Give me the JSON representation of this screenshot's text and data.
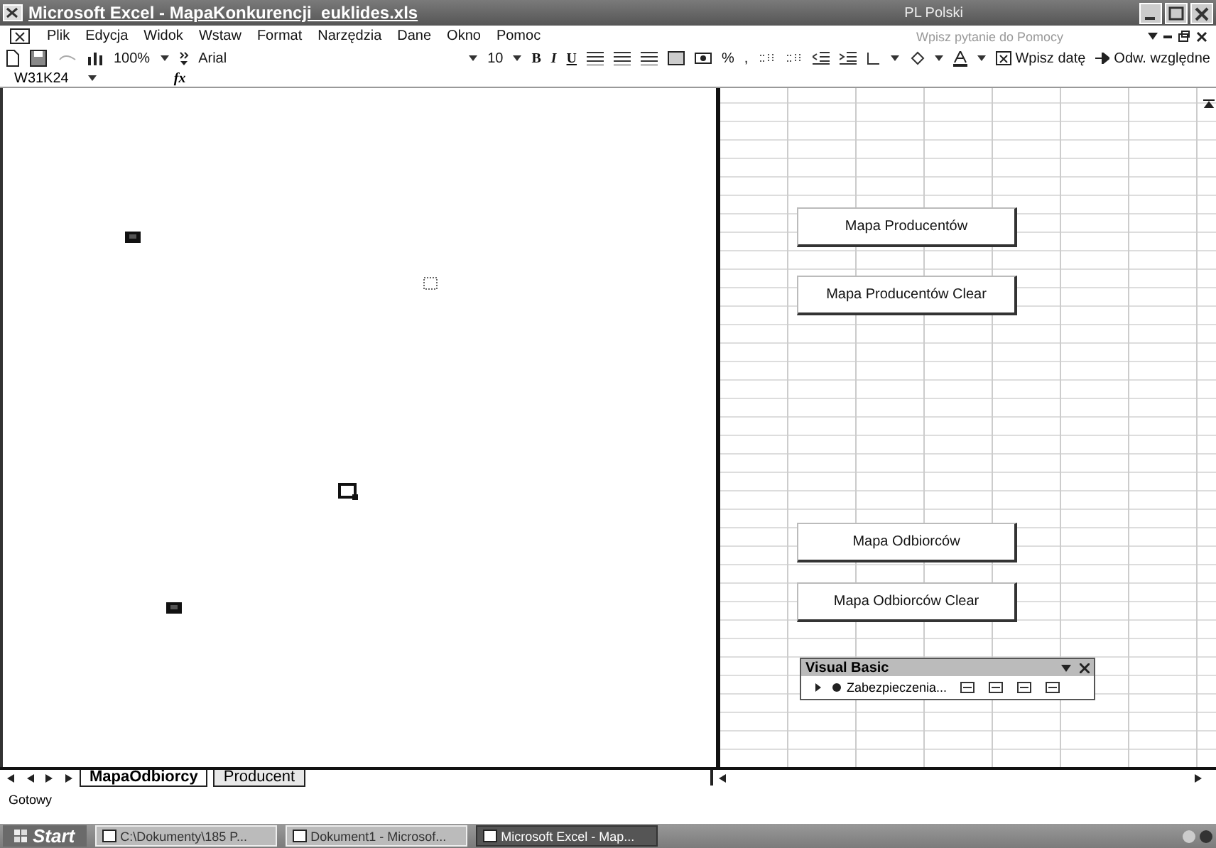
{
  "window": {
    "title": "Microsoft Excel - MapaKonkurencji_euklides.xls",
    "language": "PL Polski"
  },
  "menu": {
    "items": [
      "Plik",
      "Edycja",
      "Widok",
      "Wstaw",
      "Format",
      "Narzędzia",
      "Dane",
      "Okno",
      "Pomoc"
    ],
    "help_field": {
      "placeholder": "Wpisz pytanie do Pomocy"
    }
  },
  "toolbar": {
    "zoom": "100%",
    "font": "Arial",
    "size": "10",
    "bold": "B",
    "italic": "I",
    "underline": "U",
    "percent": "%",
    "comma": ",",
    "date_button": "Wpisz datę",
    "relative_button": "Odw. względne"
  },
  "formula_bar": {
    "name_box": "W31K24",
    "fx": "fx"
  },
  "map": {
    "markers": [
      {
        "kind": "filled"
      },
      {
        "kind": "dotted"
      },
      {
        "kind": "outline"
      },
      {
        "kind": "filled"
      }
    ]
  },
  "sheet": {
    "buttons": [
      "Mapa Producentów",
      "Mapa Producentów Clear",
      "Mapa Odbiorców",
      "Mapa Odbiorców Clear"
    ]
  },
  "vb_toolbar": {
    "title": "Visual Basic",
    "security": "Zabezpieczenia..."
  },
  "sheet_tabs": [
    {
      "label": "MapaOdbiorcy",
      "selected": true
    },
    {
      "label": "Producent",
      "selected": false
    }
  ],
  "status_bar": {
    "text": "Gotowy"
  },
  "taskbar": {
    "start": "Start",
    "tasks": [
      {
        "label": "C:\\Dokumenty\\185 P...",
        "selected": false
      },
      {
        "label": "Dokument1 - Microsof...",
        "selected": false
      },
      {
        "label": "Microsoft Excel - Map...",
        "selected": true
      }
    ]
  }
}
